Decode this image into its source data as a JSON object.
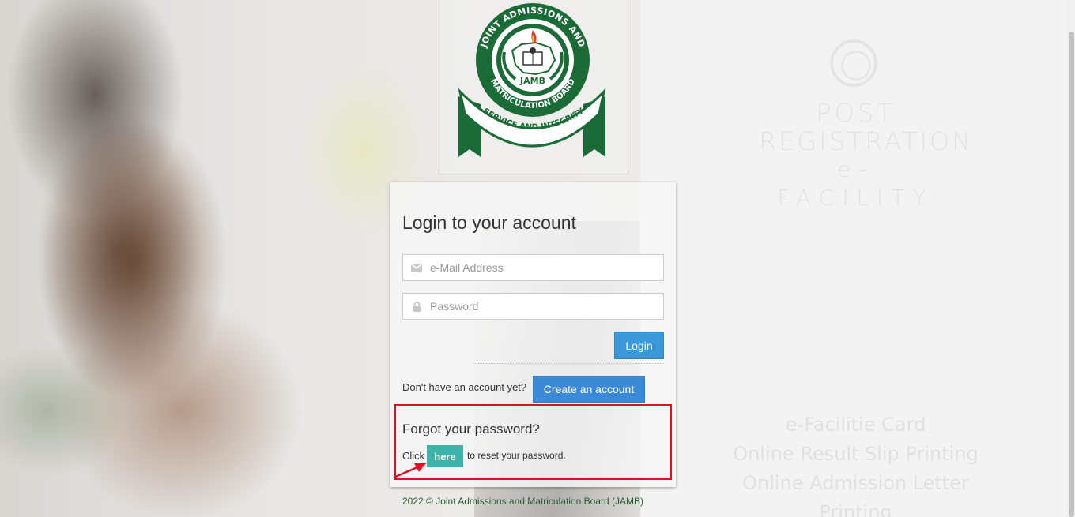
{
  "logo": {
    "top_arc_text": "JOINT ADMISSIONS AND",
    "bottom_arc_text": "MATRICULATION BOARD",
    "center_text": "JAMB",
    "ribbon_text": "SERVICE AND INTEGRITY",
    "colors": {
      "green": "#1b6b36",
      "white": "#ffffff"
    }
  },
  "watermark": {
    "title_line1": "POST",
    "title_line2": "REGISTRATION",
    "title_line3": "e-FACILITY",
    "features": [
      "e-Facilitie Card",
      "Online Result Slip Printing",
      "Online Admission Letter Printing"
    ]
  },
  "login": {
    "heading": "Login to your account",
    "email_placeholder": "e-Mail Address",
    "password_placeholder": "Password",
    "login_button": "Login",
    "no_account_text": "Don't have an account yet?",
    "create_account_button": "Create an account",
    "forgot_title": "Forgot your password?",
    "click_text": "Click",
    "here_button": "here",
    "reset_text": "to reset your password.",
    "icons": {
      "email": "envelope-icon",
      "password": "lock-icon"
    },
    "colors": {
      "login_button": "#3a97d8",
      "here_button": "#3fb2aa",
      "highlight_box": "#d9131f"
    }
  },
  "footer": {
    "text": "2022 © Joint Admissions and Matriculation Board (JAMB)"
  }
}
